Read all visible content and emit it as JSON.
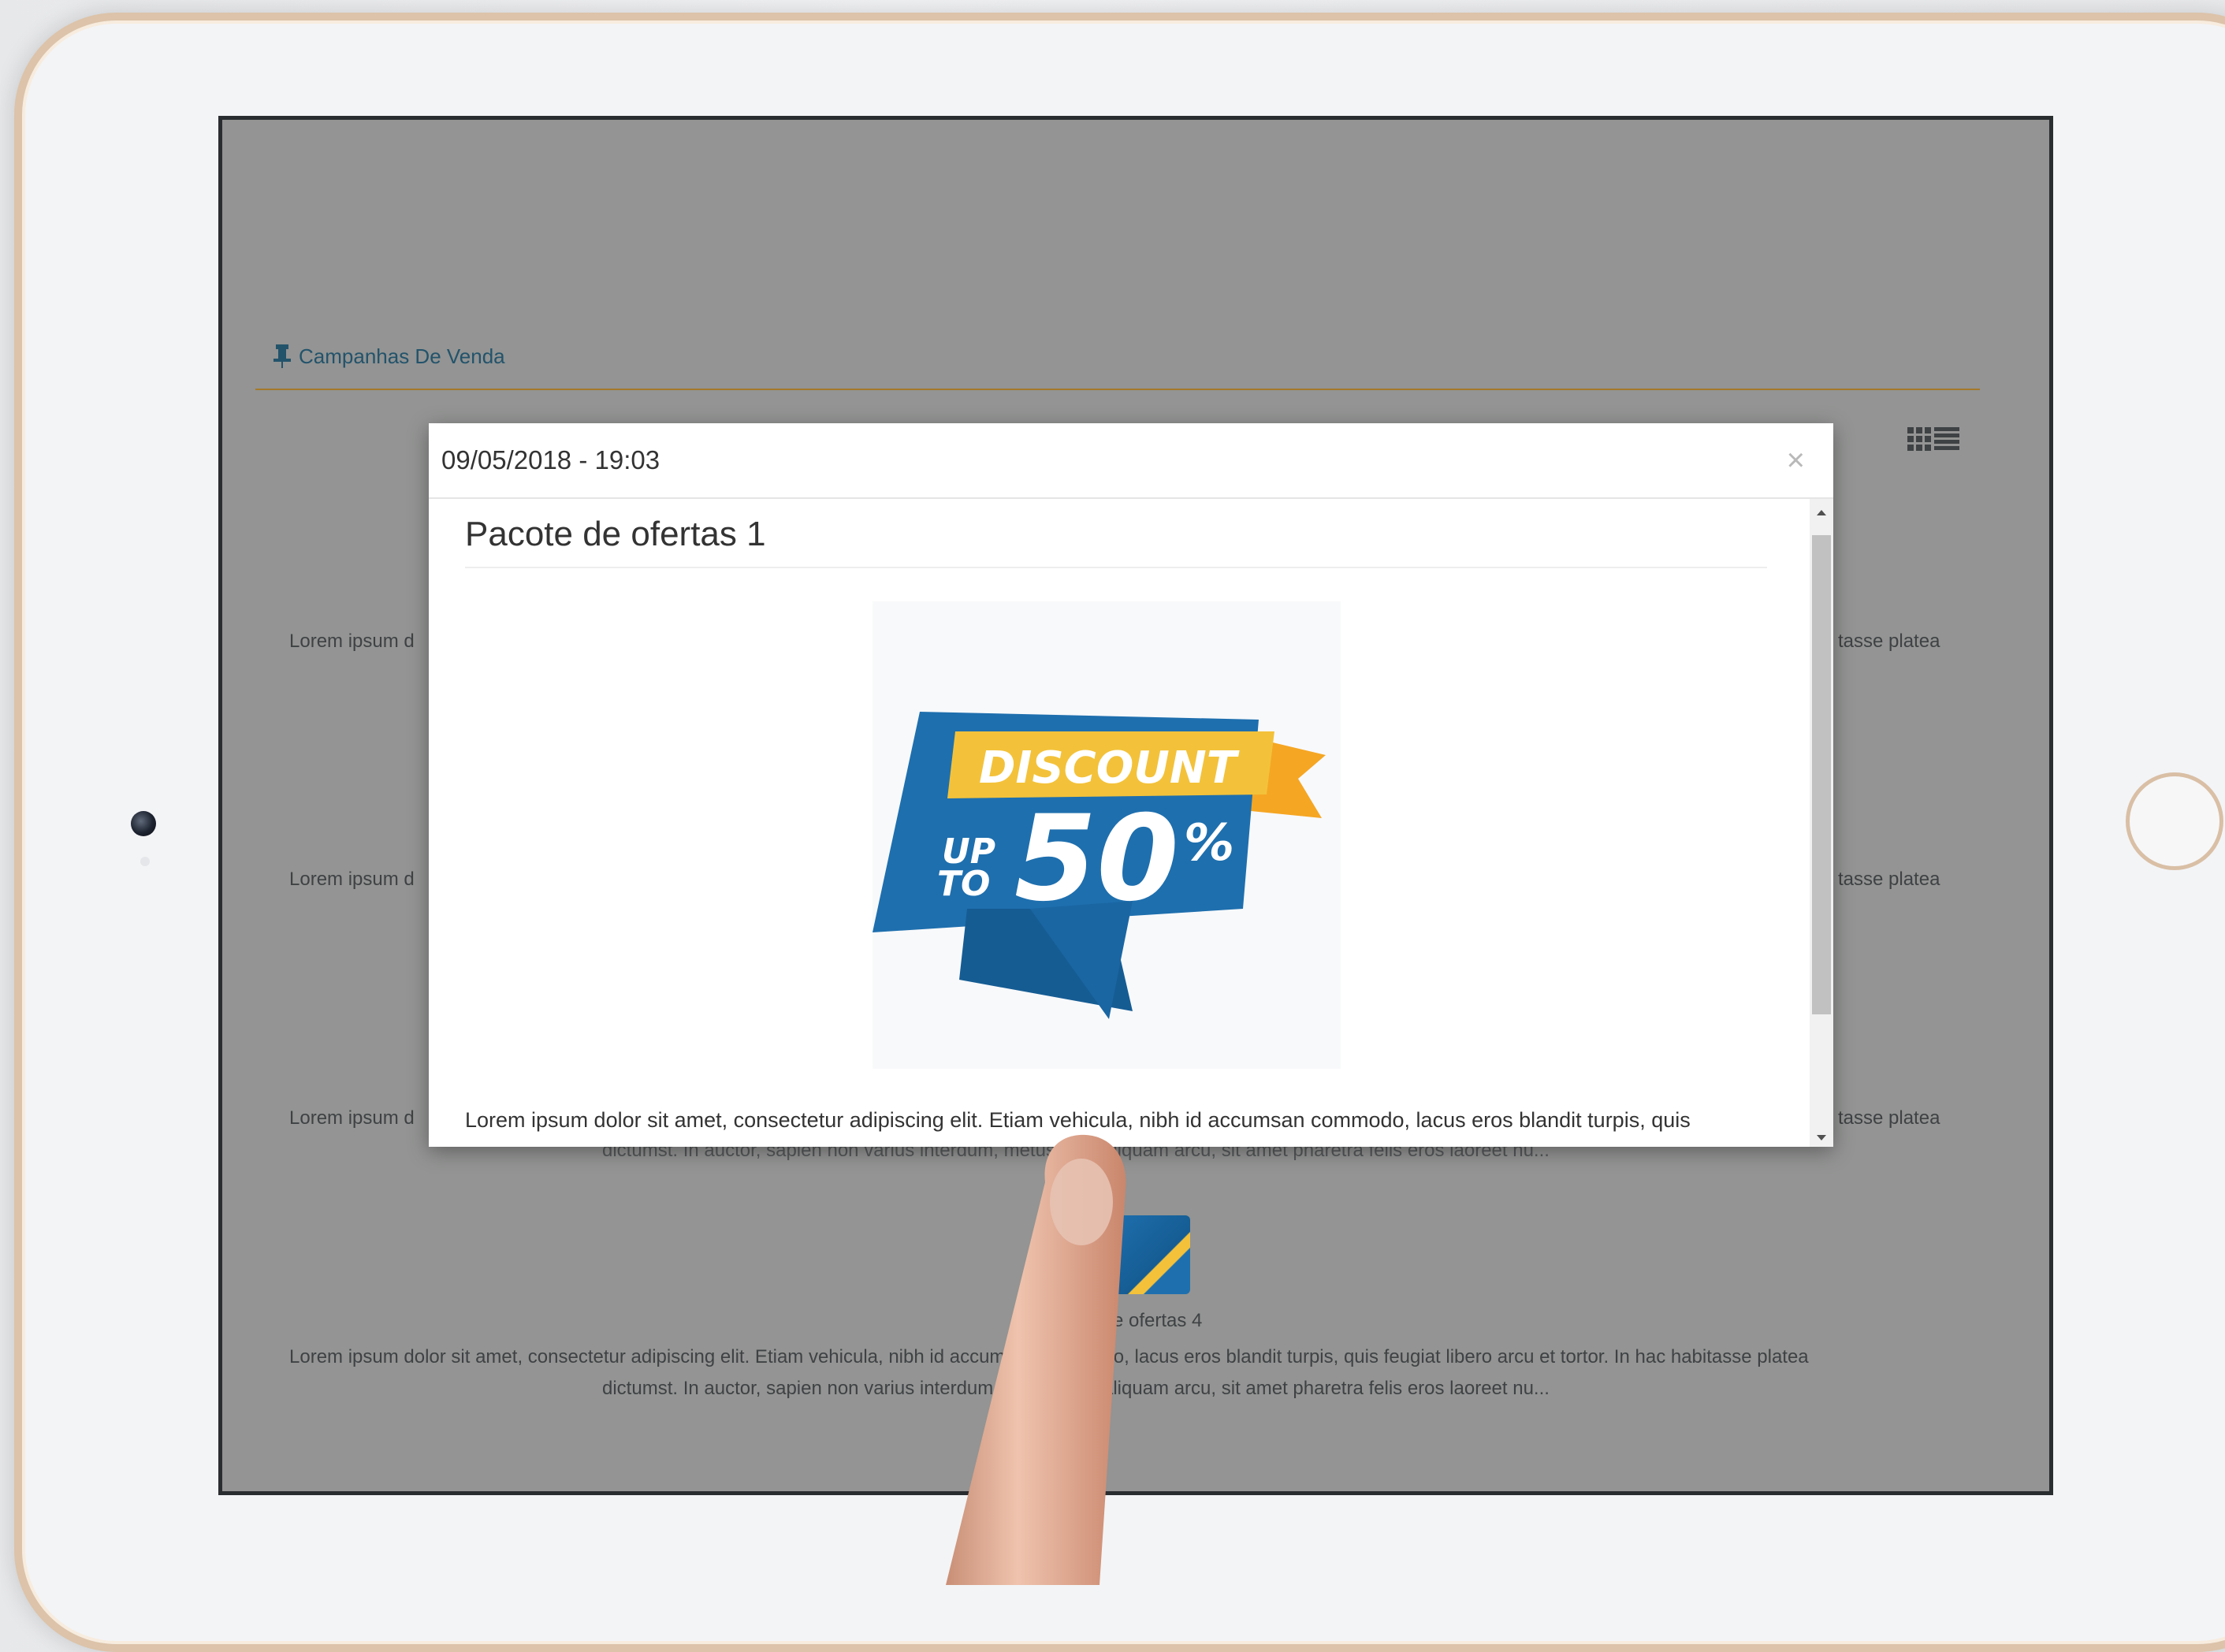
{
  "page": {
    "section_title": "Campanhas De Venda",
    "bg_rows": [
      {
        "left": "Lorem ipsum d",
        "right": "tasse platea"
      },
      {
        "left": "Lorem ipsum d",
        "right": "tasse platea"
      },
      {
        "left": "Lorem ipsum d",
        "right": "tasse platea"
      }
    ],
    "bg_partial_line": "dictumst. In auctor, sapien non varius interdum, metus ante aliquam arcu, sit amet pharetra felis eros laoreet nu...",
    "bg_caption": "e ofertas 4",
    "bg_row4_line1": "Lorem ipsum dolor sit amet, consectetur adipiscing elit. Etiam vehicula, nibh id accumsan commodo, lacus eros blandit turpis, quis feugiat libero arcu et tortor. In hac habitasse platea",
    "bg_row4_line2": "dictumst. In auctor, sapien non varius interdum, metus ante aliquam arcu, sit amet pharetra felis eros laoreet nu..."
  },
  "modal": {
    "date": "09/05/2018 - 19:03",
    "close": "×",
    "title": "Pacote de ofertas 1",
    "image_text": {
      "discount": "DISCOUNT",
      "up": "UP",
      "to": "TO",
      "amount": "50",
      "percent": "%"
    },
    "text": "Lorem ipsum dolor sit amet, consectetur adipiscing elit. Etiam vehicula, nibh id accumsan commodo, lacus eros blandit turpis, quis"
  },
  "colors": {
    "accent": "#a5782a",
    "link": "#23536b",
    "banner_blue": "#1e6fae",
    "banner_yellow": "#f3c23a",
    "banner_orange": "#f5a623"
  }
}
